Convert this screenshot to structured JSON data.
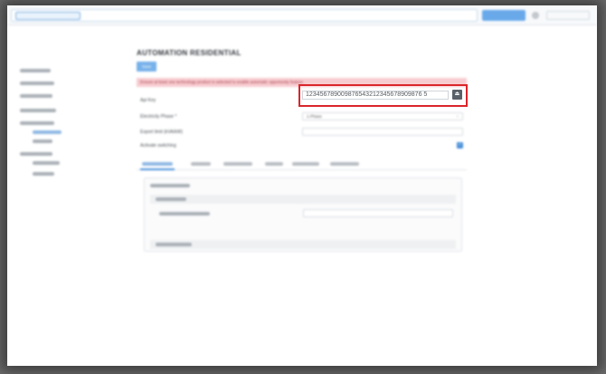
{
  "page": {
    "title": "AUTOMATION RESIDENTIAL",
    "save_label": "Save",
    "alert_text": "Ensure at least one technology product is selected to enable automatic opportunity feature."
  },
  "form": {
    "api_key_label": "Api Key",
    "api_key_value": "123456789009876543212345678909876 5",
    "electricity_phase_label": "Electricity Phase *",
    "electricity_phase_value": "1-Phase",
    "export_limit_label": "Export limit (kVA/kW)",
    "activate_switching_label": "Activate switching",
    "activate_switching_checked": true
  },
  "icons": {
    "api_key_button": "upload-icon",
    "checkbox": "check-icon",
    "dropdown": "chevron-down-icon"
  },
  "colors": {
    "highlight": "#d9262b",
    "primary": "#4a90d9",
    "alert_bg": "#f7ccd0",
    "alert_text": "#a33a45"
  }
}
